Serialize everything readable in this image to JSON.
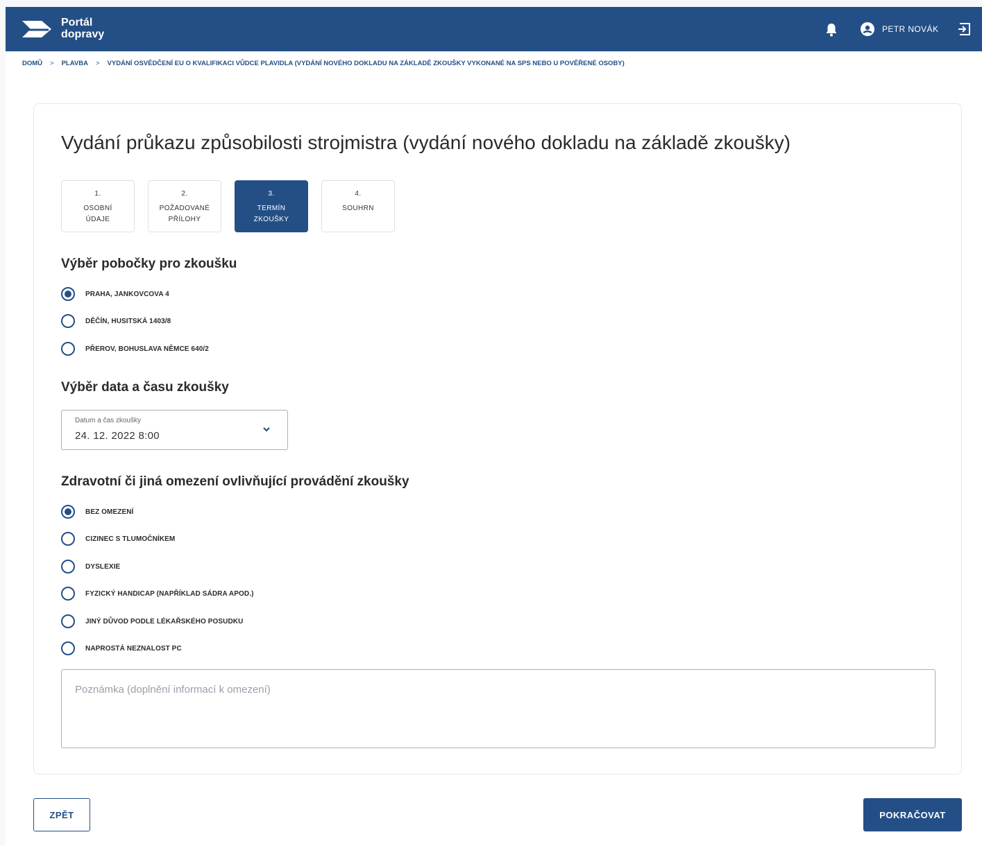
{
  "header": {
    "brand": "Portál\ndopravy",
    "user_name": "PETR NOVÁK",
    "bell_icon": "bell-icon",
    "user_icon": "account-circle-icon",
    "logout_icon": "logout-icon"
  },
  "breadcrumb": {
    "items": [
      "DOMŮ",
      "PLAVBA",
      "VYDÁNÍ OSVĚDČENÍ EU O KVALIFIKACI VŮDCE PLAVIDLA (VYDÁNÍ NOVÉHO DOKLADU NA ZÁKLADĚ ZKOUŠKY VYKONANÉ NA SPS NEBO U POVĚŘENÉ OSOBY)"
    ],
    "separator": ">"
  },
  "page_title": "Vydání průkazu způsobilosti strojmistra (vydání nového dokladu na základě zkoušky)",
  "steps": [
    {
      "num": "1.",
      "label": "OSOBNÍ\nÚDAJE",
      "active": false
    },
    {
      "num": "2.",
      "label": "POŽADOVANÉ\nPŘÍLOHY",
      "active": false
    },
    {
      "num": "3.",
      "label": "TERMÍN\nZKOUŠKY",
      "active": true
    },
    {
      "num": "4.",
      "label": "SOUHRN",
      "active": false
    }
  ],
  "branch_section": {
    "title": "Výběr pobočky pro zkoušku",
    "options": [
      "PRAHA, JANKOVCOVA 4",
      "DĚČÍN, HUSITSKÁ 1403/8",
      "PŘEROV, BOHUSLAVA NĚMCE 640/2"
    ],
    "selected_index": 0
  },
  "date_section": {
    "title": "Výběr data a času zkoušky",
    "field_label": "Datum a čas zkoušky",
    "field_value": "24. 12. 2022 8:00"
  },
  "restriction_section": {
    "title": "Zdravotní či jiná omezení ovlivňující provádění zkoušky",
    "options": [
      "BEZ OMEZENÍ",
      "CIZINEC S TLUMOČNÍKEM",
      "DYSLEXIE",
      "FYZICKÝ HANDICAP (NAPŘÍKLAD SÁDRA APOD.)",
      "JINÝ DŮVOD PODLE LÉKAŘSKÉHO POSUDKU",
      "NAPROSTÁ NEZNALOST PC"
    ],
    "selected_index": 0,
    "note_placeholder": "Poznámka (doplnění informací k omezení)"
  },
  "buttons": {
    "back": "ZPĚT",
    "next": "POKRAČOVAT"
  },
  "colors": {
    "primary": "#234f86",
    "page_background": "#f7f8fa"
  }
}
